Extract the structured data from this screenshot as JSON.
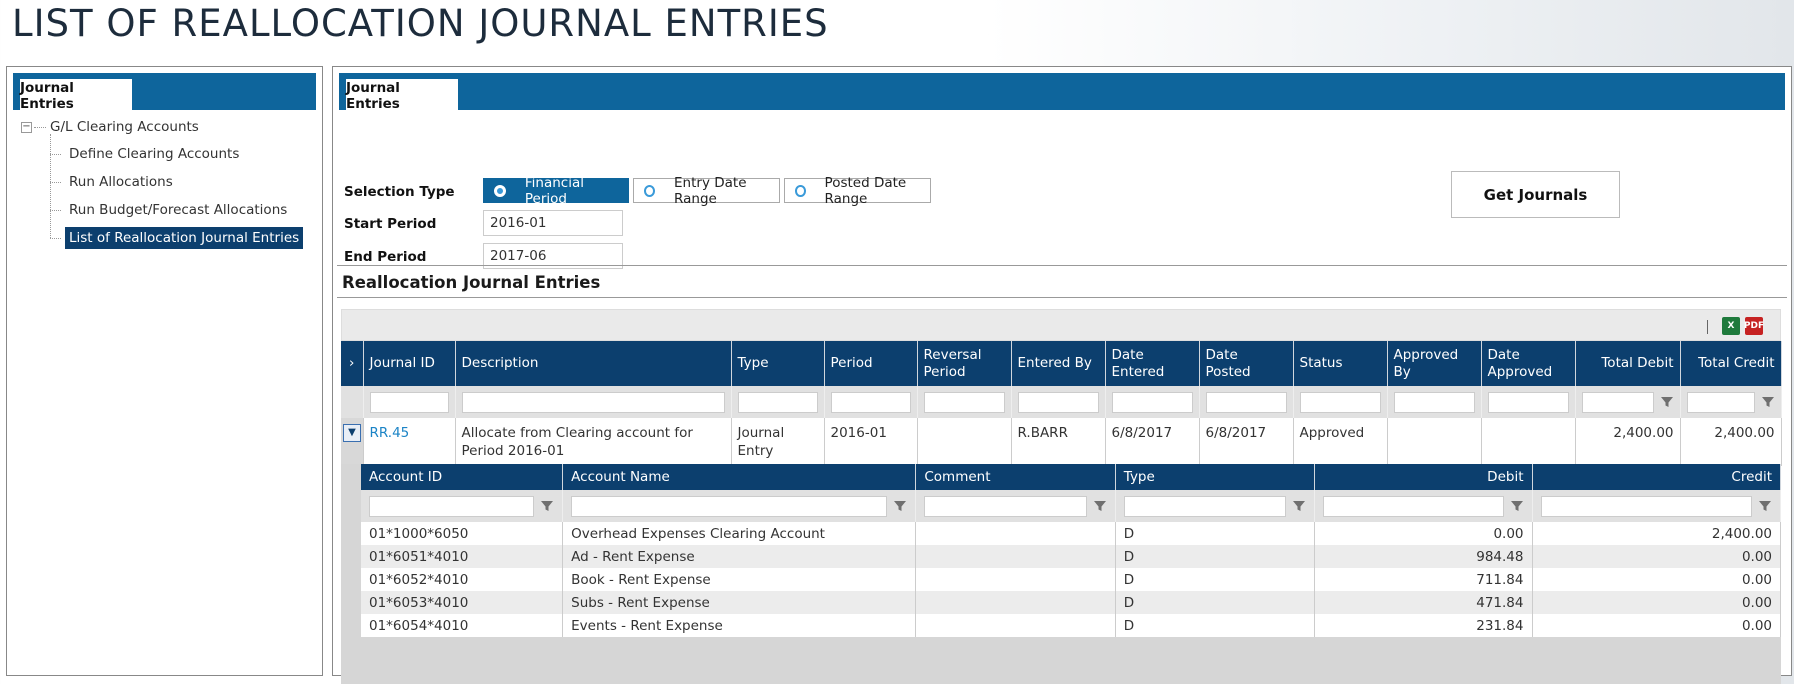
{
  "page": {
    "title": "LIST OF REALLOCATION JOURNAL ENTRIES"
  },
  "left_panel": {
    "tab_label": "Journal Entries",
    "tree": {
      "root_label": "G/L Clearing Accounts",
      "children": [
        {
          "label": "Define Clearing Accounts",
          "selected": false
        },
        {
          "label": "Run Allocations",
          "selected": false
        },
        {
          "label": "Run Budget/Forecast Allocations",
          "selected": false
        },
        {
          "label": "List of Reallocation Journal Entries",
          "selected": true
        }
      ]
    }
  },
  "right_panel": {
    "tab_label": "Journal Entries",
    "form": {
      "selection_type_label": "Selection Type",
      "options": [
        {
          "label": "Financial Period",
          "selected": true
        },
        {
          "label": "Entry Date Range",
          "selected": false
        },
        {
          "label": "Posted Date Range",
          "selected": false
        }
      ],
      "start_period_label": "Start Period",
      "start_period_value": "2016-01",
      "end_period_label": "End Period",
      "end_period_value": "2017-06",
      "get_journals_label": "Get Journals"
    },
    "section_title": "Reallocation Journal Entries",
    "grid": {
      "toolbar": {
        "excel_icon": "excel-export-icon",
        "pdf_icon": "pdf-export-icon"
      },
      "columns": [
        "Journal ID",
        "Description",
        "Type",
        "Period",
        "Reversal Period",
        "Entered By",
        "Date Entered",
        "Date Posted",
        "Status",
        "Approved By",
        "Date Approved",
        "Total Debit",
        "Total Credit"
      ],
      "rows": [
        {
          "journal_id": "RR.45",
          "description": "Allocate from Clearing account for Period 2016-01",
          "type": "Journal Entry",
          "period": "2016-01",
          "reversal_period": "",
          "entered_by": "R.BARR",
          "date_entered": "6/8/2017",
          "date_posted": "6/8/2017",
          "status": "Approved",
          "approved_by": "",
          "date_approved": "",
          "total_debit": "2,400.00",
          "total_credit": "2,400.00"
        }
      ],
      "detail": {
        "columns": [
          "Account ID",
          "Account Name",
          "Comment",
          "Type",
          "Debit",
          "Credit"
        ],
        "lines": [
          {
            "account_id": "01*1000*6050",
            "account_name": "Overhead Expenses Clearing Account",
            "comment": "",
            "type": "D",
            "debit": "0.00",
            "credit": "2,400.00"
          },
          {
            "account_id": "01*6051*4010",
            "account_name": "Ad - Rent Expense",
            "comment": "",
            "type": "D",
            "debit": "984.48",
            "credit": "0.00"
          },
          {
            "account_id": "01*6052*4010",
            "account_name": "Book - Rent Expense",
            "comment": "",
            "type": "D",
            "debit": "711.84",
            "credit": "0.00"
          },
          {
            "account_id": "01*6053*4010",
            "account_name": "Subs - Rent Expense",
            "comment": "",
            "type": "D",
            "debit": "471.84",
            "credit": "0.00"
          },
          {
            "account_id": "01*6054*4010",
            "account_name": "Events - Rent Expense",
            "comment": "",
            "type": "D",
            "debit": "231.84",
            "credit": "0.00"
          }
        ]
      }
    }
  },
  "colors": {
    "brand_blue": "#0e659c",
    "header_navy": "#0c3f6e",
    "link": "#1c84c6"
  }
}
